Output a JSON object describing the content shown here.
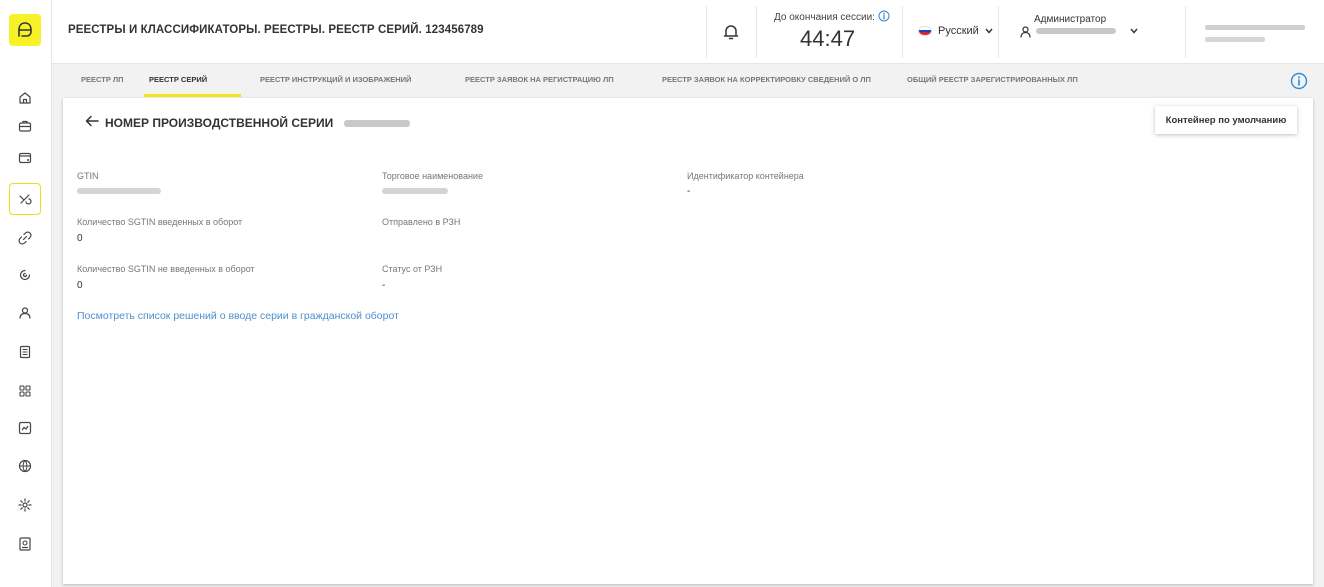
{
  "sidebar": {
    "icons": [
      "home-icon",
      "briefcase-icon",
      "wallet-icon",
      "pill-icon",
      "link-icon",
      "refresh-cycle-icon",
      "user-icon",
      "document-list-icon",
      "grid-icon",
      "chart-icon",
      "globe-icon",
      "settings-icon",
      "archive-icon"
    ],
    "active_index": 3
  },
  "header": {
    "title": "РЕЕСТРЫ И КЛАССИФИКАТОРЫ. РЕЕСТРЫ. РЕЕСТР СЕРИЙ. 123456789",
    "session_label": "До окончания сессии:",
    "session_time": "44:47",
    "language": "Русский",
    "user_role": "Администратор"
  },
  "tabs": [
    {
      "label": "РЕЕСТР ЛП"
    },
    {
      "label": "РЕЕСТР СЕРИЙ",
      "active": true
    },
    {
      "label": "РЕЕСТР ИНСТРУКЦИЙ И ИЗОБРАЖЕНИЙ"
    },
    {
      "label": "РЕЕСТР ЗАЯВОК НА РЕГИСТРАЦИЮ ЛП"
    },
    {
      "label": "РЕЕСТР ЗАЯВОК НА КОРРЕКТИРОВКУ СВЕДЕНИЙ О ЛП"
    },
    {
      "label": "ОБЩИЙ РЕЕСТР ЗАРЕГИСТРИРОВАННЫХ ЛП"
    }
  ],
  "content": {
    "title": "НОМЕР ПРОИЗВОДСТВЕННОЙ СЕРИИ",
    "container_button": "Контейнер по умолчанию",
    "fields": {
      "gtin_label": "GTIN",
      "trade_name_label": "Торговое наименование",
      "container_id_label": "Идентификатор контейнера",
      "container_id_value": "-",
      "sgtin_in_label": "Количество SGTIN введенных в оборот",
      "sgtin_in_value": "0",
      "sent_rzn_label": "Отправлено в РЗН",
      "sgtin_out_label": "Количество SGTIN не введенных в оборот",
      "sgtin_out_value": "0",
      "rzn_status_label": "Статус от РЗН",
      "rzn_status_value": "-"
    },
    "decisions_link": "Посмотреть список решений о вводе серии в гражданской оборот"
  },
  "colors": {
    "accent": "#f2e625",
    "link": "#4f8fcf",
    "info": "#2f8ad8"
  }
}
